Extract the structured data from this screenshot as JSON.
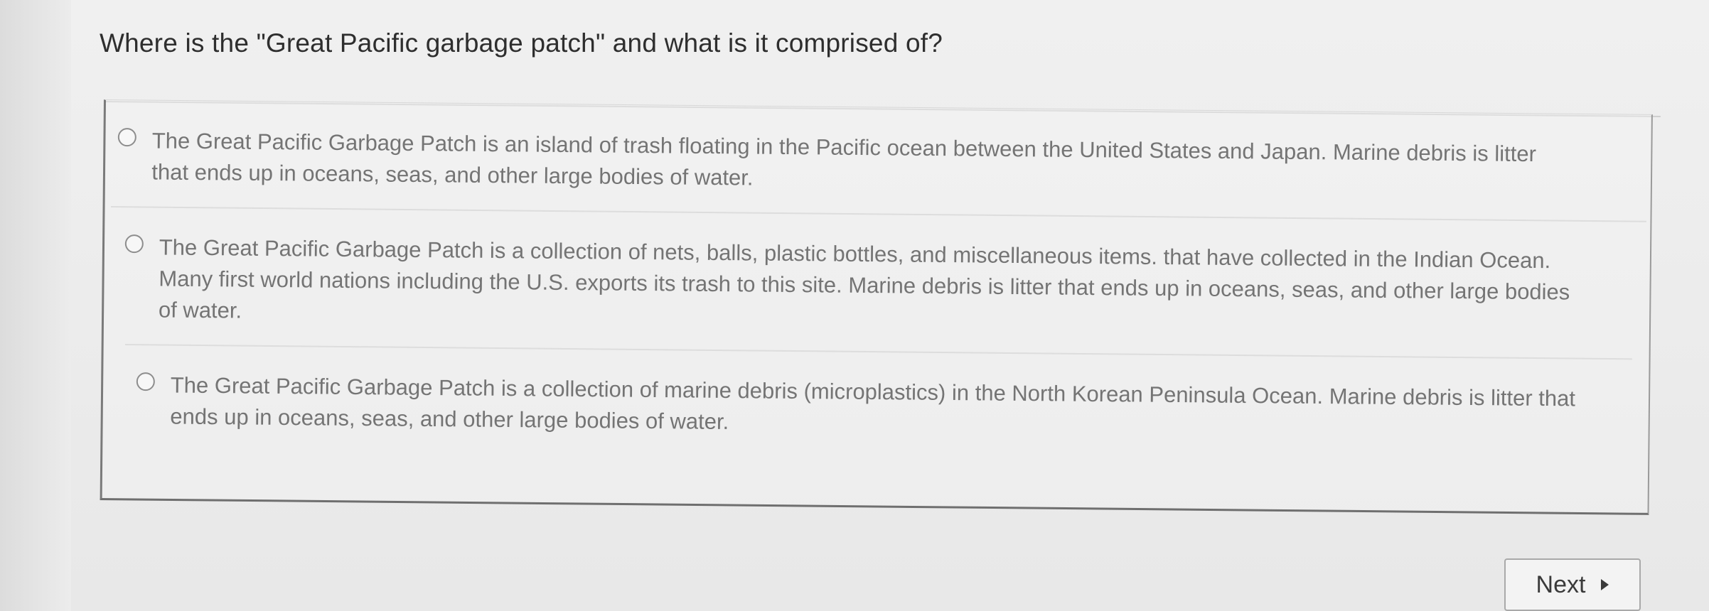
{
  "question": {
    "text": "Where is the \"Great Pacific garbage patch\" and what is it comprised of?"
  },
  "options": [
    {
      "lines": [
        "The Great Pacific Garbage Patch is an island of trash floating in the Pacific ocean between the United States and Japan.  Marine debris is litter",
        "that ends up in oceans, seas, and other large bodies of water."
      ],
      "selected": false
    },
    {
      "lines": [
        "The Great Pacific Garbage Patch is a collection of nets, balls, plastic bottles, and miscellaneous items. that have collected in the Indian Ocean.",
        "Many first world nations including the U.S. exports its trash to this site.  Marine debris is litter that ends up in oceans, seas, and other large bodies",
        "of water."
      ],
      "selected": false
    },
    {
      "lines": [
        "The Great Pacific Garbage Patch is a collection of marine debris (microplastics) in the North Korean Peninsula Ocean. Marine debris is litter that",
        "ends up in oceans, seas, and other large bodies of water."
      ],
      "selected": false
    }
  ],
  "navigation": {
    "next_label": "Next",
    "next_icon": "triangle-right-icon"
  }
}
